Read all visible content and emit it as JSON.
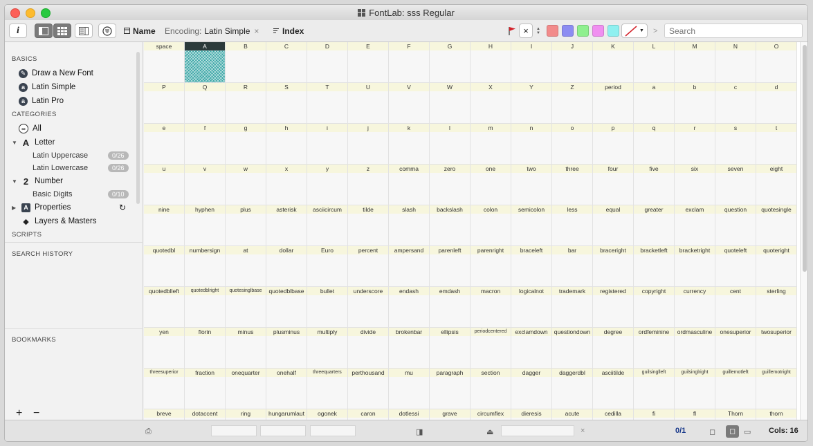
{
  "window": {
    "title": "FontLab: sss Regular"
  },
  "toolbar": {
    "info_label": "i",
    "name_label": "Name",
    "encoding_key": "Encoding:",
    "encoding_value": "Latin Simple",
    "encoding_close": "×",
    "index_label": "Index",
    "clear_label": "×",
    "search_placeholder": "Search",
    "more_label": ">",
    "colors": [
      "#f28b8b",
      "#8c8cf2",
      "#8ff08f",
      "#f08ff0",
      "#8ff0f0"
    ]
  },
  "sidebar": {
    "basics_header": "BASICS",
    "basics": [
      "Draw a New Font",
      "Latin Simple",
      "Latin Pro"
    ],
    "categories_header": "CATEGORIES",
    "all_label": "All",
    "letter_label": "Letter",
    "latin_upper": "Latin Uppercase",
    "latin_upper_badge": "0/26",
    "latin_lower": "Latin Lowercase",
    "latin_lower_badge": "0/26",
    "number_label": "Number",
    "basic_digits": "Basic Digits",
    "basic_digits_badge": "0/10",
    "properties_label": "Properties",
    "layers_label": "Layers & Masters",
    "scripts_header": "SCRIPTS",
    "search_history_header": "SEARCH HISTORY",
    "bookmarks_header": "BOOKMARKS",
    "add_label": "+",
    "remove_label": "−"
  },
  "glyphs": [
    "space",
    "A",
    "B",
    "C",
    "D",
    "E",
    "F",
    "G",
    "H",
    "I",
    "J",
    "K",
    "L",
    "M",
    "N",
    "O",
    "P",
    "Q",
    "R",
    "S",
    "T",
    "U",
    "V",
    "W",
    "X",
    "Y",
    "Z",
    "period",
    "a",
    "b",
    "c",
    "d",
    "e",
    "f",
    "g",
    "h",
    "i",
    "j",
    "k",
    "l",
    "m",
    "n",
    "o",
    "p",
    "q",
    "r",
    "s",
    "t",
    "u",
    "v",
    "w",
    "x",
    "y",
    "z",
    "comma",
    "zero",
    "one",
    "two",
    "three",
    "four",
    "five",
    "six",
    "seven",
    "eight",
    "nine",
    "hyphen",
    "plus",
    "asterisk",
    "asciicircum",
    "tilde",
    "slash",
    "backslash",
    "colon",
    "semicolon",
    "less",
    "equal",
    "greater",
    "exclam",
    "question",
    "quotesingle",
    "quotedbl",
    "numbersign",
    "at",
    "dollar",
    "Euro",
    "percent",
    "ampersand",
    "parenleft",
    "parenright",
    "braceleft",
    "bar",
    "braceright",
    "bracketleft",
    "bracketright",
    "quoteleft",
    "quoteright",
    "quotedblleft",
    "quotedblright",
    "quotesinglbase",
    "quotedblbase",
    "bullet",
    "underscore",
    "endash",
    "emdash",
    "macron",
    "logicalnot",
    "trademark",
    "registered",
    "copyright",
    "currency",
    "cent",
    "sterling",
    "yen",
    "florin",
    "minus",
    "plusminus",
    "multiply",
    "divide",
    "brokenbar",
    "ellipsis",
    "periodcentered",
    "exclamdown",
    "questiondown",
    "degree",
    "ordfeminine",
    "ordmasculine",
    "onesuperior",
    "twosuperior",
    "threesuperior",
    "fraction",
    "onequarter",
    "onehalf",
    "threequarters",
    "perthousand",
    "mu",
    "paragraph",
    "section",
    "dagger",
    "daggerdbl",
    "asciitilde",
    "guilsinglleft",
    "guilsinglright",
    "guillemotleft",
    "guillemotright",
    "breve",
    "dotaccent",
    "ring",
    "hungarumlaut",
    "ogonek",
    "caron",
    "dotlessi",
    "grave",
    "circumflex",
    "dieresis",
    "acute",
    "cedilla",
    "fi",
    "fl",
    "Thorn",
    "thorn"
  ],
  "selected_glyph": "A",
  "status": {
    "selection": "0/1",
    "cols_label": "Cols: 16",
    "close_label": "×"
  }
}
